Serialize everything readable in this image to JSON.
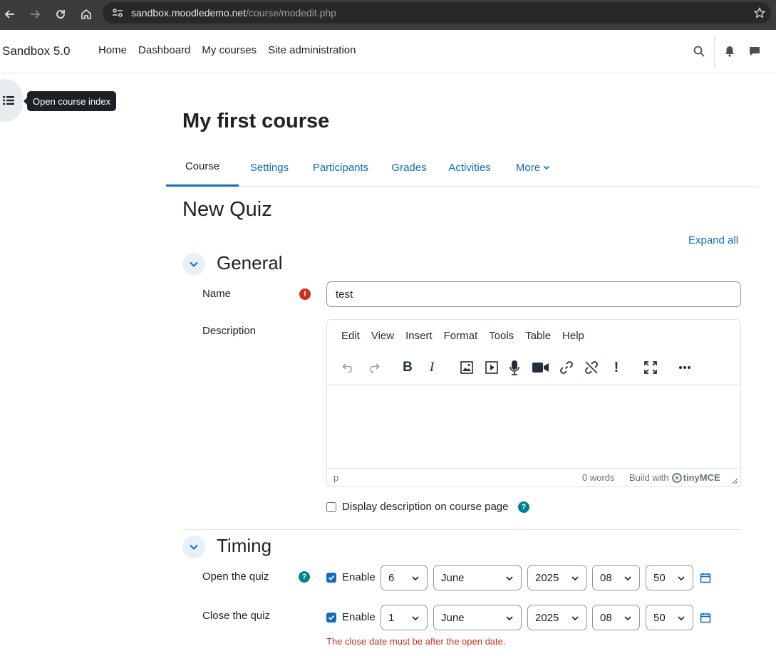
{
  "browser": {
    "url_host": "sandbox.moodledemo.net",
    "url_path": "/course/modedit.php"
  },
  "navbar": {
    "brand": "Sandbox 5.0",
    "items": [
      "Home",
      "Dashboard",
      "My courses",
      "Site administration"
    ]
  },
  "course_index": {
    "tooltip": "Open course index"
  },
  "course": {
    "title": "My first course",
    "tabs": [
      "Course",
      "Settings",
      "Participants",
      "Grades",
      "Activities",
      "More"
    ]
  },
  "page": {
    "heading": "New Quiz",
    "expand_all": "Expand all"
  },
  "general": {
    "title": "General",
    "name_label": "Name",
    "name_value": "test",
    "description_label": "Description",
    "editor_menu": [
      "Edit",
      "View",
      "Insert",
      "Format",
      "Tools",
      "Table",
      "Help"
    ],
    "status_path": "p",
    "status_words": "0 words",
    "status_build": "Build with",
    "status_brand": "tinyMCE",
    "display_description_label": "Display description on course page"
  },
  "timing": {
    "title": "Timing",
    "open_label": "Open the quiz",
    "close_label": "Close the quiz",
    "enable_label": "Enable",
    "open": {
      "day": "6",
      "month": "June",
      "year": "2025",
      "hour": "08",
      "minute": "50"
    },
    "close": {
      "day": "1",
      "month": "June",
      "year": "2025",
      "hour": "08",
      "minute": "50"
    },
    "error": "The close date must be after the open date."
  },
  "colors": {
    "primary": "#0f6cbf",
    "danger": "#ca3120",
    "info": "#008196"
  }
}
